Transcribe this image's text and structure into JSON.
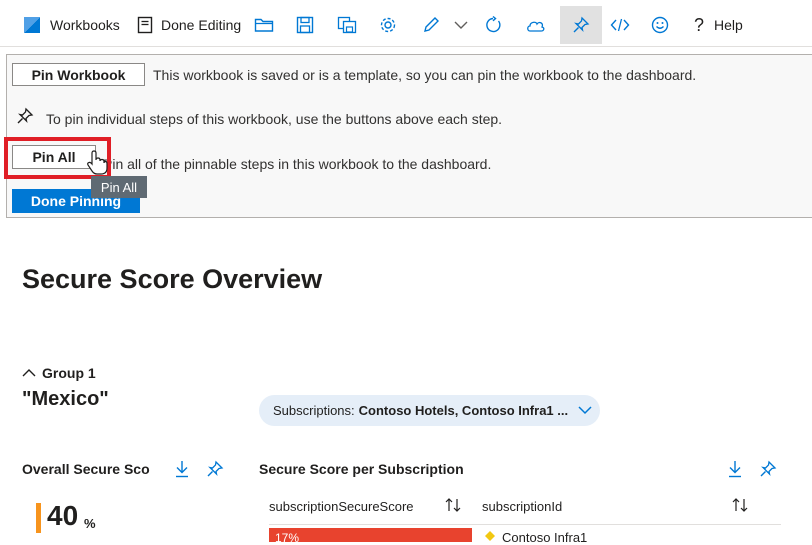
{
  "toolbar": {
    "workbooks_label": "Workbooks",
    "done_editing_label": "Done Editing",
    "help_label": "Help",
    "icons": [
      "workbooks-logo-icon",
      "done-editing-icon",
      "open-folder-icon",
      "save-icon",
      "save-as-icon",
      "settings-gear-icon",
      "edit-pencil-icon",
      "chevron-down-icon",
      "refresh-icon",
      "share-icon",
      "pin-icon",
      "code-icon",
      "feedback-smiley-icon",
      "help-icon"
    ]
  },
  "banner": {
    "pin_workbook_label": "Pin Workbook",
    "pin_workbook_text": "This workbook is saved or is a template, so you can pin the workbook to the dashboard.",
    "pin_steps_text": "To pin individual steps of this workbook, use the buttons above each step.",
    "pin_all_label": "Pin All",
    "pin_all_text": "Pin all of the pinnable steps in this workbook to the dashboard.",
    "tooltip": "Pin All",
    "done_pinning_label": "Done Pinning"
  },
  "page": {
    "title": "Secure Score Overview",
    "group_label": "Group 1",
    "group_name": "\"Mexico\"",
    "subscriptions_label": "Subscriptions:",
    "subscriptions_value": "Contoso Hotels, Contoso Infra1 ..."
  },
  "overall": {
    "title": "Overall Secure Scor",
    "value": "40",
    "unit": "%",
    "accent": "#f7941d"
  },
  "per_subscription": {
    "title": "Secure Score per Subscription",
    "columns": [
      "subscriptionSecureScore",
      "subscriptionId"
    ],
    "rows": [
      {
        "score": "17%",
        "id": "Contoso Infra1"
      }
    ],
    "bar_color": "#e8432e"
  },
  "colors": {
    "primary": "#0078d4",
    "highlight": "#e01e26"
  }
}
